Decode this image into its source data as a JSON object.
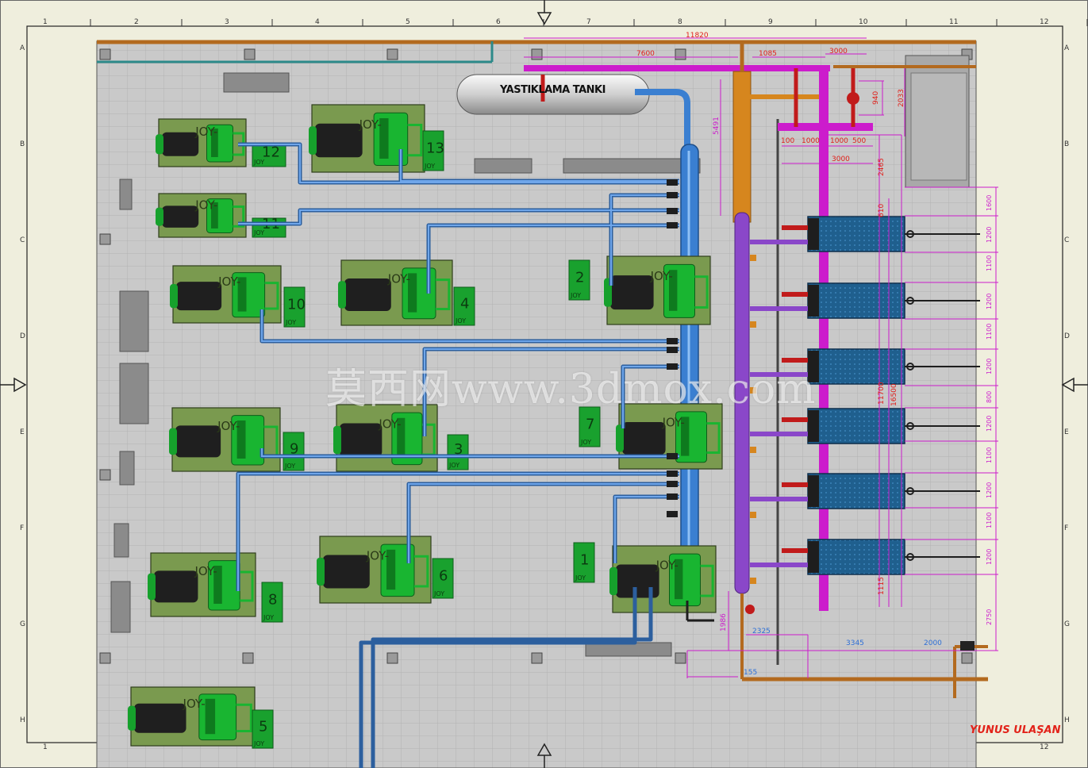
{
  "drawing": {
    "tank_label": "YASTIKLAMA TANKI",
    "watermark": "莫西网www.3dmox.com",
    "signature": "YUNUS ULAŞAN",
    "brand": "JOY",
    "column_numbers": [
      "1",
      "2",
      "3",
      "4",
      "5",
      "6",
      "7",
      "8",
      "9",
      "10",
      "11",
      "12"
    ],
    "row_letters": [
      "A",
      "B",
      "C",
      "D",
      "E",
      "F",
      "G",
      "H"
    ],
    "units": [
      "1",
      "2",
      "3",
      "4",
      "5",
      "6",
      "7",
      "8",
      "9",
      "10",
      "11",
      "12",
      "13"
    ],
    "dimensions_red": [
      "11820",
      "7600",
      "1085",
      "3000",
      "940",
      "2033",
      "100",
      "1000",
      "1000",
      "500",
      "3000",
      "2465",
      "610",
      "11700",
      "16500",
      "1115",
      "5491"
    ],
    "dimensions_magenta": [
      "1600",
      "1200",
      "1100",
      "1200",
      "1100",
      "1200",
      "800",
      "1200",
      "1100",
      "1200",
      "1100",
      "1200",
      "2750"
    ],
    "dimensions_blue": [
      "2325",
      "3345",
      "2000",
      "155",
      "1986"
    ]
  }
}
